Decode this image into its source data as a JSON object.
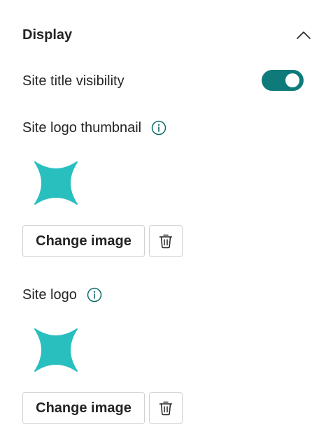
{
  "section": {
    "title": "Display",
    "collapse_icon": "chevron-up-icon"
  },
  "site_title_visibility": {
    "label": "Site title visibility",
    "toggle_on": true,
    "toggle_color": "#0e7a7a"
  },
  "site_logo_thumbnail": {
    "label": "Site logo thumbnail",
    "info_icon": "info-icon",
    "logo_icon": "four-point-star-logo",
    "logo_color": "#2abfbf",
    "change_label": "Change image",
    "delete_icon": "trash-icon"
  },
  "site_logo": {
    "label": "Site logo",
    "info_icon": "info-icon",
    "logo_icon": "four-point-star-logo",
    "logo_color": "#2abfbf",
    "change_label": "Change image",
    "delete_icon": "trash-icon"
  }
}
